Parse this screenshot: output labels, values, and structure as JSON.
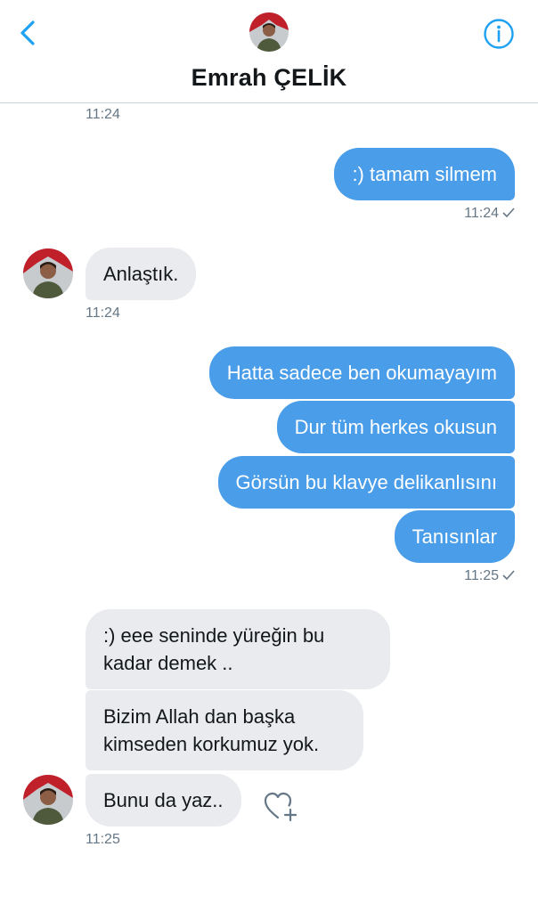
{
  "header": {
    "contact_name": "Emrah ÇELİK",
    "back_icon": "chevron-left-icon",
    "info_icon": "info-icon"
  },
  "colors": {
    "outgoing_bubble": "#4a9de8",
    "incoming_bubble": "#e9ebee",
    "accent": "#1da1f2"
  },
  "messages": {
    "ts_top": "11:24",
    "m1": ":) tamam silmem",
    "ts_m1": "11:24",
    "m2": "Anlaştık.",
    "ts_m2": "11:24",
    "m3": "Hatta sadece ben okumayayım",
    "m4": "Dur tüm herkes okusun",
    "m5": "Görsün bu klavye delikanlısını",
    "m6": "Tanısınlar",
    "ts_m6": "11:25",
    "m7": ":)  eee  seninde yüreğin  bu kadar demek ..",
    "m8": "Bizim Allah dan başka kimseden korkumuz yok.",
    "m9": "Bunu da yaz..",
    "ts_m9": "11:25"
  }
}
